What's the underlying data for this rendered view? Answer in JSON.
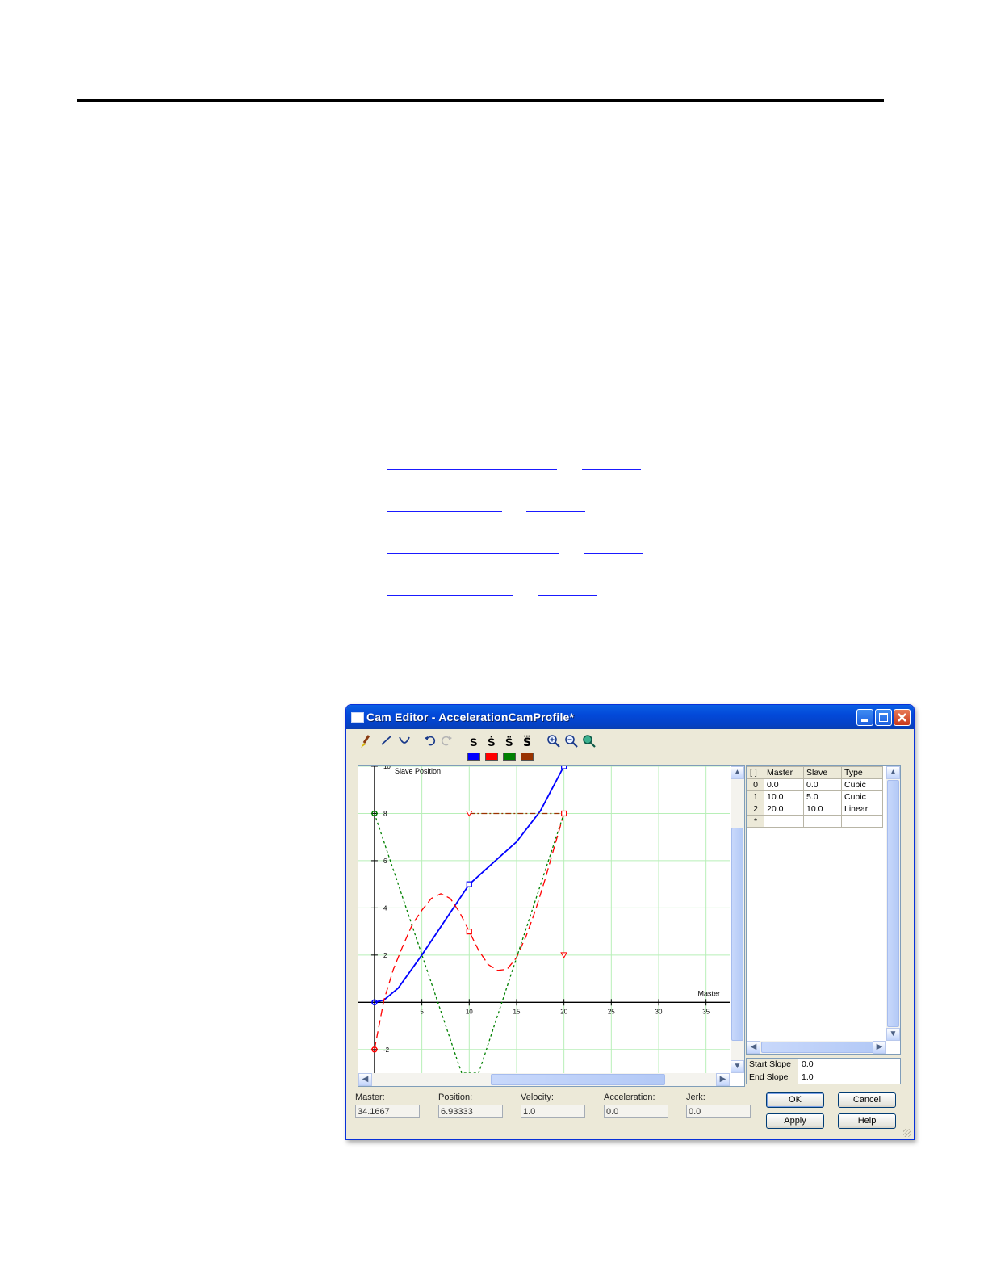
{
  "links": [
    {
      "text": "",
      "ref": ""
    },
    {
      "text": "",
      "ref": ""
    },
    {
      "text": "",
      "ref": ""
    },
    {
      "text": "",
      "ref": ""
    }
  ],
  "window": {
    "title": "Cam Editor - AccelerationCamProfile*"
  },
  "toolbar": {
    "icons": [
      "brush-icon",
      "line-icon",
      "curve-icon",
      "undo-icon",
      "redo-icon",
      "zoom-in-icon",
      "zoom-out-icon",
      "zoom-fit-icon"
    ],
    "series_buttons": [
      {
        "label": "S",
        "color": "#0000ff"
      },
      {
        "label": "Ṡ",
        "color": "#ff0000"
      },
      {
        "label": "S̈",
        "color": "#008000"
      },
      {
        "label": "S⃛",
        "color": "#993300"
      }
    ]
  },
  "chart_data": {
    "type": "line",
    "title": "",
    "ylabel": "Slave Position",
    "xlabel": "Master",
    "xlim": [
      -1.7,
      37.5
    ],
    "ylim": [
      -3.0,
      10.0
    ],
    "x_ticks": [
      5,
      10,
      15,
      20,
      25,
      30,
      35
    ],
    "y_ticks": [
      -2,
      2,
      4,
      6,
      8,
      10
    ],
    "y_tick_labels": [
      "-2",
      "2",
      "4",
      "6",
      "8",
      "10"
    ],
    "grid": true,
    "series": [
      {
        "color": "#0000ff",
        "style": "solid",
        "x": [
          0,
          1,
          2.5,
          5,
          7.5,
          10,
          12.5,
          15,
          17.5,
          20
        ],
        "y": [
          0,
          0.1,
          0.6,
          2.0,
          3.5,
          5.0,
          5.9,
          6.8,
          8.1,
          10.0
        ]
      },
      {
        "color": "#ff0000",
        "style": "dashed",
        "x": [
          0,
          1,
          2,
          3,
          4,
          5,
          6,
          7,
          8,
          9,
          10,
          11,
          12,
          13,
          14,
          15,
          16,
          17,
          18,
          19,
          20
        ],
        "y": [
          -2,
          0.1,
          1.4,
          2.4,
          3.3,
          3.9,
          4.4,
          4.6,
          4.4,
          3.8,
          3.0,
          2.2,
          1.6,
          1.35,
          1.4,
          1.9,
          2.8,
          3.9,
          5.2,
          6.6,
          8.0
        ]
      },
      {
        "color": "#008000",
        "style": "dotted",
        "x": [
          0,
          9.2,
          11,
          20
        ],
        "y": [
          8,
          -3,
          -3,
          8
        ]
      },
      {
        "color": "#993300",
        "style": "dashdot",
        "x": [
          10,
          20
        ],
        "y": [
          8,
          8
        ]
      }
    ],
    "markers": [
      {
        "x": 0,
        "y": 0,
        "shape": "circle",
        "color": "#0000ff"
      },
      {
        "x": 10,
        "y": 5,
        "shape": "square",
        "color": "#0000ff"
      },
      {
        "x": 20,
        "y": 10,
        "shape": "square",
        "color": "#0000ff"
      },
      {
        "x": 10,
        "y": 3,
        "shape": "square",
        "color": "#ff0000"
      },
      {
        "x": 20,
        "y": 8,
        "shape": "square",
        "color": "#ff0000"
      },
      {
        "x": 10,
        "y": 8,
        "shape": "triangle",
        "color": "#ff0000"
      },
      {
        "x": 20,
        "y": 2,
        "shape": "triangle",
        "color": "#ff0000"
      },
      {
        "x": 0,
        "y": 8,
        "shape": "circle",
        "color": "#008000"
      },
      {
        "x": 0,
        "y": -2,
        "shape": "circle",
        "color": "#ff0000"
      }
    ]
  },
  "points_table": {
    "headers": [
      "[ ]",
      "Master",
      "Slave",
      "Type"
    ],
    "rows": [
      [
        "0",
        "0.0",
        "0.0",
        "Cubic"
      ],
      [
        "1",
        "10.0",
        "5.0",
        "Cubic"
      ],
      [
        "2",
        "20.0",
        "10.0",
        "Linear"
      ],
      [
        "*",
        "",
        "",
        ""
      ]
    ]
  },
  "slopes": [
    {
      "label": "Start Slope",
      "value": "0.0"
    },
    {
      "label": "End Slope",
      "value": "1.0"
    }
  ],
  "readouts": [
    {
      "label": "Master:",
      "value": "34.1667"
    },
    {
      "label": "Position:",
      "value": "6.93333"
    },
    {
      "label": "Velocity:",
      "value": "1.0"
    },
    {
      "label": "Acceleration:",
      "value": "0.0"
    },
    {
      "label": "Jerk:",
      "value": "0.0"
    }
  ],
  "buttons": {
    "ok": "OK",
    "cancel": "Cancel",
    "apply": "Apply",
    "help": "Help"
  }
}
